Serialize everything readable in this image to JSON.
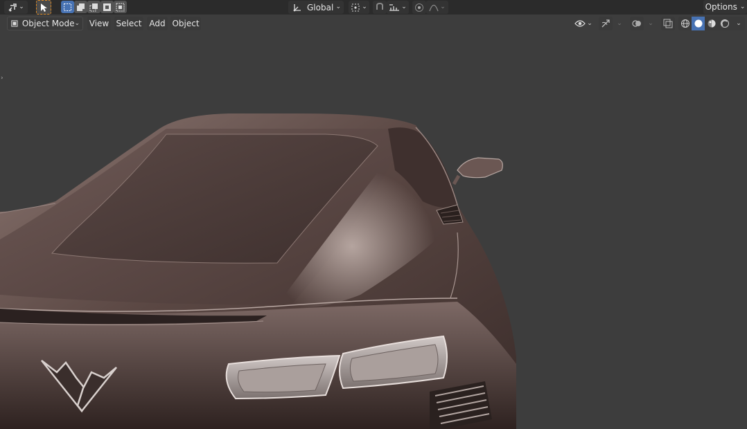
{
  "top_toolbar": {
    "transform_orientation": "Global",
    "options_label": "Options"
  },
  "header": {
    "mode_label": "Object Mode",
    "menus": [
      "View",
      "Select",
      "Add",
      "Object"
    ]
  },
  "icons": {
    "editor_type": "editor-type-icon",
    "select_tool": "cursor-icon",
    "select_box_modes": [
      "select-new-icon",
      "select-extend-icon",
      "select-subtract-icon",
      "select-invert-icon",
      "select-intersect-icon"
    ],
    "orientation": "orientation-icon",
    "pivot": "pivot-point-icon",
    "snap": "magnet-icon",
    "snap_target": "snap-increment-icon",
    "proportional": "proportional-edit-icon",
    "falloff": "falloff-curve-icon",
    "visibility": "eye-icon",
    "gizmo": "gizmo-icon",
    "overlays": "overlays-icon",
    "xray": "xray-icon",
    "shading": [
      "wireframe-icon",
      "solid-icon",
      "material-preview-icon",
      "rendered-icon"
    ]
  },
  "colors": {
    "viewport_background": "#3d3d3d",
    "car_body": "#5e4a47",
    "active_accent": "#4772b3"
  }
}
